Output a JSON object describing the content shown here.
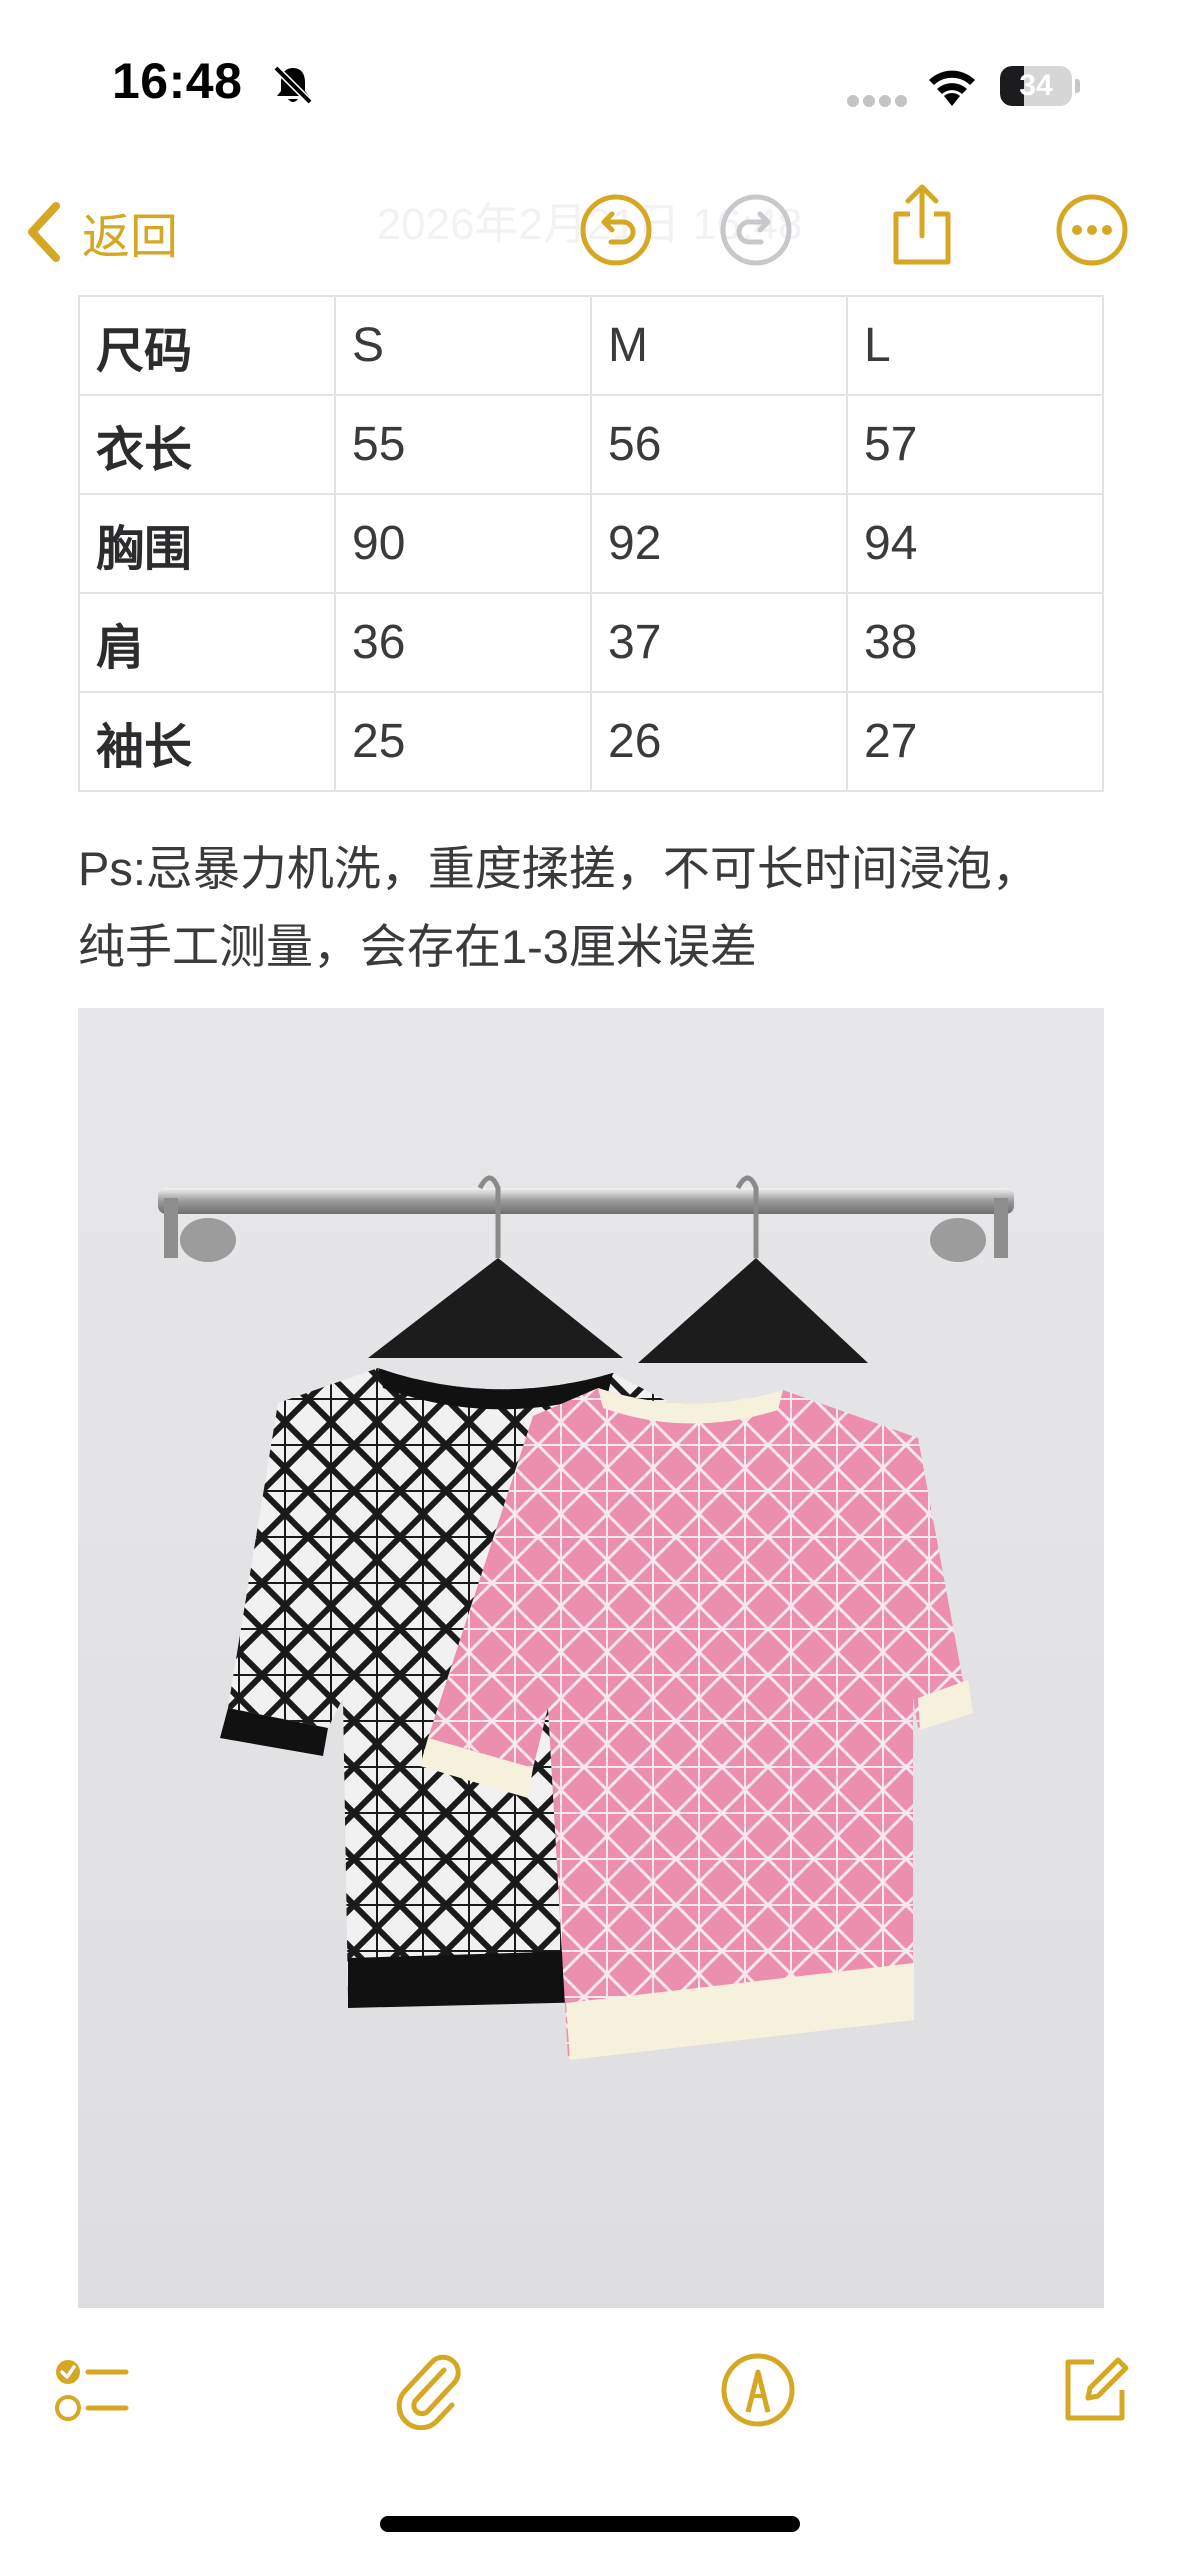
{
  "status_bar": {
    "time": "16:48",
    "battery_level": "34",
    "battery_fraction": 0.34,
    "icons": [
      "bell-slash-icon",
      "cellular-signal-icon",
      "wifi-icon",
      "battery-icon"
    ]
  },
  "nav": {
    "back_label": "返回",
    "title": "2026年2月21日 16:48",
    "icons": [
      "chevron-left-icon",
      "undo-icon",
      "redo-icon",
      "share-icon",
      "more-icon"
    ]
  },
  "size_table": {
    "rows": [
      [
        "尺码",
        "S",
        "M",
        "L"
      ],
      [
        "衣长",
        "55",
        "56",
        "57"
      ],
      [
        "胸围",
        "90",
        "92",
        "94"
      ],
      [
        "肩",
        "36",
        "37",
        "38"
      ],
      [
        "袖长",
        "25",
        "26",
        "27"
      ]
    ]
  },
  "note": {
    "line1": "Ps:忌暴力机洗，重度揉搓，不可长时间浸泡，",
    "line2": "纯手工测量，会存在1-3厘米误差"
  },
  "toolbar": {
    "icons": [
      "checklist-icon",
      "paperclip-icon",
      "markup-icon",
      "compose-icon"
    ]
  },
  "colors": {
    "accent": "#d6a722",
    "pink": "#ec8fae",
    "cream": "#f6f1dc"
  }
}
